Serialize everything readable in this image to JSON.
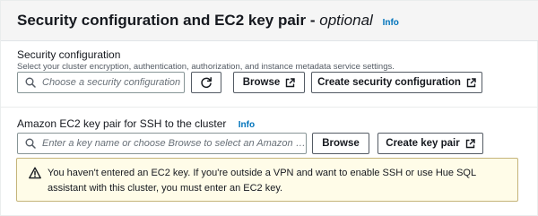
{
  "header": {
    "title": "Security configuration and EC2 key pair -",
    "optional_label": "optional",
    "info_label": "Info"
  },
  "security": {
    "label": "Security configuration",
    "description": "Select your cluster encryption, authentication, authorization, and instance metadata service settings.",
    "input_placeholder": "Choose a security configuration",
    "browse_label": "Browse",
    "create_label": "Create security configuration"
  },
  "keypair": {
    "label": "Amazon EC2 key pair for SSH to the cluster",
    "info_label": "Info",
    "input_placeholder": "Enter a key name or choose Browse to select an Amazon EC2 ...",
    "browse_label": "Browse",
    "create_label": "Create key pair"
  },
  "alert": {
    "message": "You haven't entered an EC2 key. If you're outside a VPN and want to enable SSH or use Hue SQL assistant with this cluster, you must enter an EC2 key."
  },
  "icons": {
    "search": "search-icon",
    "refresh": "refresh-icon",
    "external": "external-link-icon",
    "warning": "warning-icon"
  },
  "colors": {
    "link": "#0073bb",
    "alert_bg": "#fffce8",
    "alert_border": "#c5b47a"
  }
}
